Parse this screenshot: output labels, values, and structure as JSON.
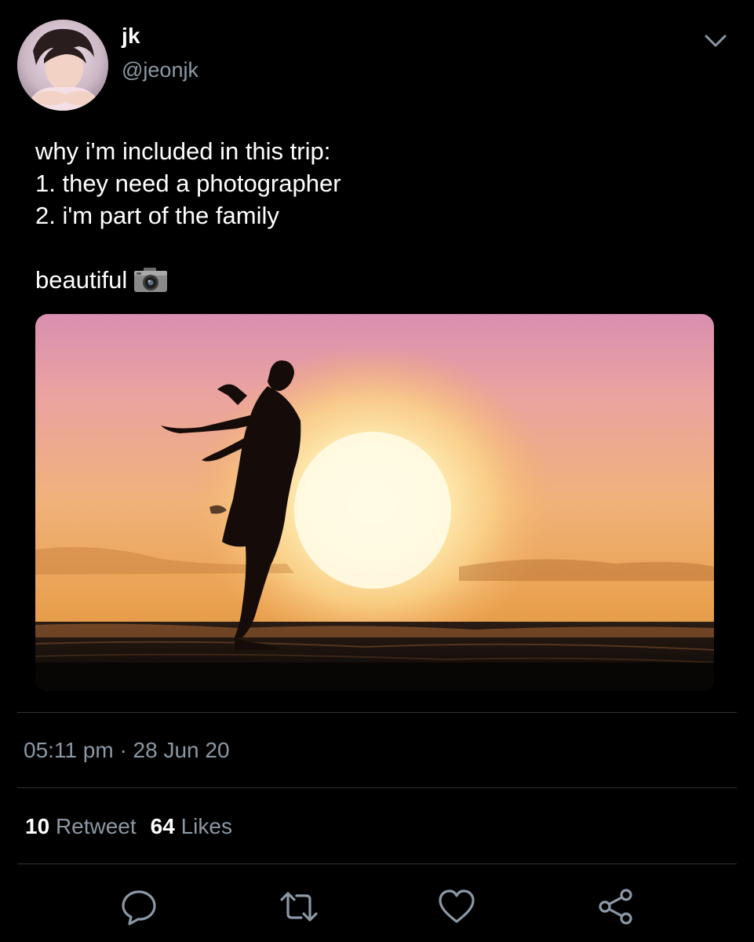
{
  "author": {
    "display_name": "jk",
    "handle": "@jeonjk"
  },
  "tweet": {
    "lines": [
      "why i'm included in this trip:",
      "1. they need a photographer",
      "2. i'm part of the family"
    ],
    "closing": "beautiful",
    "emoji_icon": "camera-icon",
    "media_icon": "sunset-silhouette-photo"
  },
  "meta": {
    "timestamp": "05:11 pm · 28 Jun 20"
  },
  "stats": {
    "retweet_count": "10",
    "retweet_label": "Retweet",
    "likes_count": "64",
    "likes_label": "Likes"
  },
  "actions": [
    {
      "icon": "reply-icon"
    },
    {
      "icon": "retweet-icon"
    },
    {
      "icon": "like-icon"
    },
    {
      "icon": "share-icon"
    }
  ],
  "colors": {
    "background": "#000000",
    "primary_text": "#ffffff",
    "secondary_text": "#8b98a5",
    "divider": "#2f3336"
  }
}
